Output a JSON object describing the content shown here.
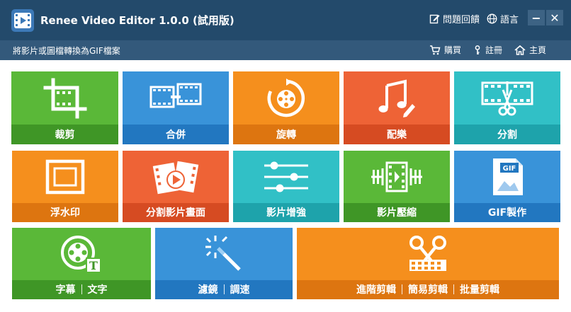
{
  "window": {
    "title": "Renee Video Editor 1.0.0 (試用版)",
    "help_label": "問題回饋",
    "language_label": "語言",
    "minimize_glyph": "−",
    "close_glyph": "✕"
  },
  "subbar": {
    "subtitle": "將影片或圖檔轉換為GIF檔案",
    "buy_label": "購買",
    "register_label": "註冊",
    "home_label": "主頁"
  },
  "tiles": {
    "crop": {
      "label": "裁剪",
      "icon": "crop-icon"
    },
    "merge": {
      "label": "合併",
      "icon": "film-merge-icon"
    },
    "rotate": {
      "label": "旋轉",
      "icon": "rotate-film-icon"
    },
    "music": {
      "label": "配樂",
      "icon": "music-note-icon"
    },
    "split": {
      "label": "分割",
      "icon": "film-scissors-icon"
    },
    "watermark": {
      "label": "浮水印",
      "icon": "watermark-frame-icon"
    },
    "split_screen": {
      "label": "分割影片畫面",
      "icon": "split-screen-play-icon"
    },
    "enhance": {
      "label": "影片增強",
      "icon": "sliders-icon"
    },
    "compress": {
      "label": "影片壓縮",
      "icon": "compress-film-icon"
    },
    "gif": {
      "label": "GIF製作",
      "icon": "gif-file-icon",
      "badge": "GIF"
    },
    "subtitle_text": {
      "labels": [
        "字幕",
        "文字"
      ],
      "icon": "film-text-icon",
      "badge": "T"
    },
    "filter_speed": {
      "labels": [
        "濾鏡",
        "調速"
      ],
      "icon": "magic-wand-icon"
    },
    "advanced_edit": {
      "labels": [
        "進階剪輯",
        "簡易剪輯",
        "批量剪輯"
      ],
      "icon": "scissors-film-icon"
    }
  },
  "colors": {
    "titlebar": "#234a6b",
    "subbar": "#33597b",
    "green": "#5ab838",
    "blue": "#3993d9",
    "orange": "#f58f1d",
    "red": "#ee6336",
    "teal": "#31c0c6",
    "selected_outline": "#c8192a"
  }
}
